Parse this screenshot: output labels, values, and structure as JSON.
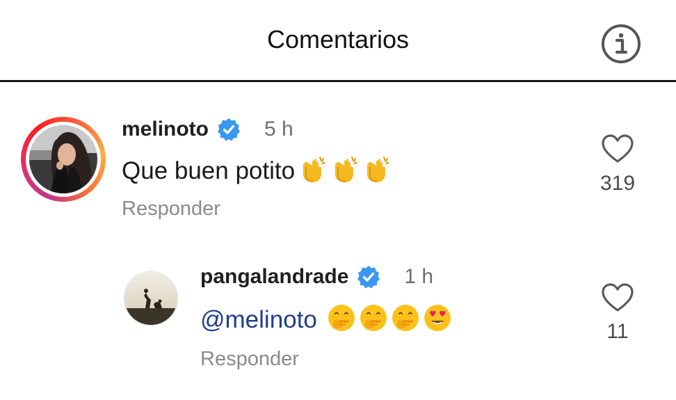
{
  "header": {
    "title": "Comentarios",
    "info_icon": "info-icon"
  },
  "comments": [
    {
      "username": "melinoto",
      "verified": true,
      "time": "5 h",
      "text": "Que buen potito",
      "emojis": [
        "clapping-hands",
        "clapping-hands",
        "clapping-hands"
      ],
      "reply_label": "Responder",
      "likes": "319",
      "has_story_ring": true
    },
    {
      "username": "pangalandrade",
      "verified": true,
      "time": "1 h",
      "mention": "@melinoto",
      "emojis": [
        "face-with-hand-over-mouth",
        "face-with-hand-over-mouth",
        "face-with-hand-over-mouth",
        "heart-eyes-face"
      ],
      "reply_label": "Responder",
      "likes": "11",
      "has_story_ring": false
    }
  ],
  "colors": {
    "verified_blue": "#3897f0",
    "mention": "#1e3d8f",
    "secondary_text": "#8a8a8a"
  }
}
